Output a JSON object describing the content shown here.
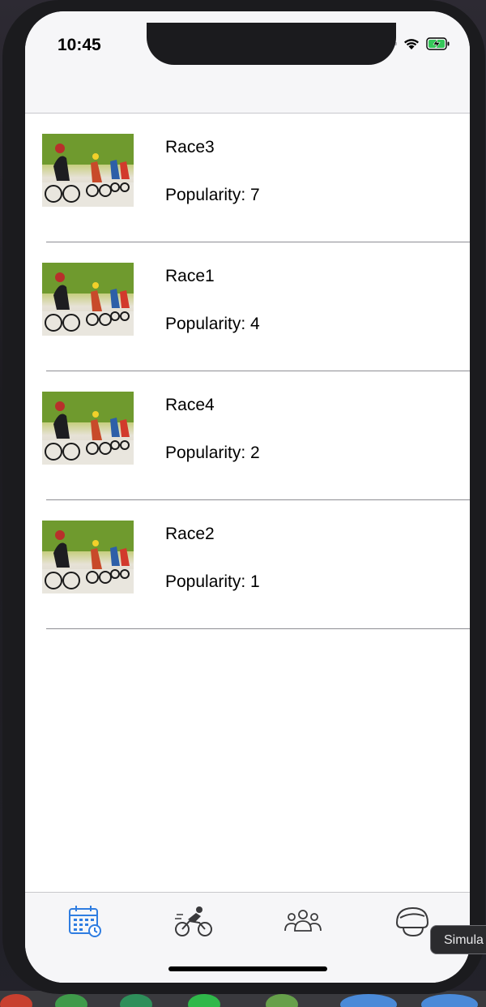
{
  "status_bar": {
    "time": "10:45"
  },
  "races": [
    {
      "name": "Race3",
      "popularity": "Popularity: 7"
    },
    {
      "name": "Race1",
      "popularity": "Popularity: 4"
    },
    {
      "name": "Race4",
      "popularity": "Popularity: 2"
    },
    {
      "name": "Race2",
      "popularity": "Popularity: 1"
    }
  ],
  "tab_bar": {
    "selected_index": 0,
    "tabs": [
      {
        "icon": "calendar-icon"
      },
      {
        "icon": "cyclist-icon"
      },
      {
        "icon": "group-icon"
      },
      {
        "icon": "helmet-icon"
      }
    ]
  },
  "tooltip": {
    "label": "Simula"
  },
  "colors": {
    "accent": "#2f7de1",
    "inactive_icon": "#3a3a3c",
    "separator": "#8e8e93",
    "bar_background": "#f6f6f8"
  }
}
